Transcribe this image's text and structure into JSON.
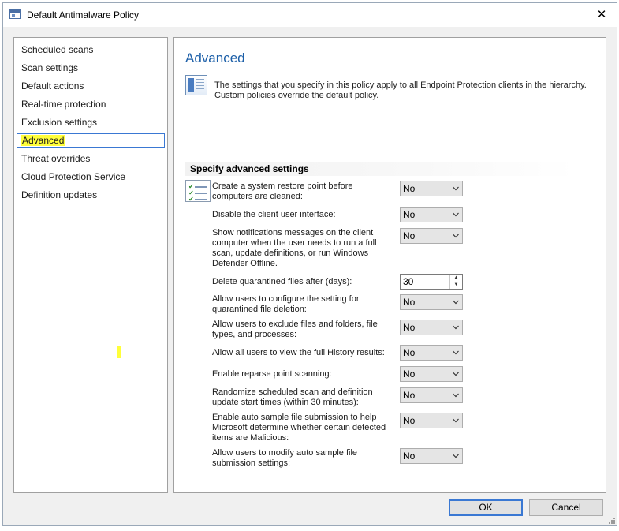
{
  "window": {
    "title": "Default Antimalware Policy",
    "close_glyph": "✕"
  },
  "sidebar": {
    "items": [
      {
        "label": "Scheduled scans"
      },
      {
        "label": "Scan settings"
      },
      {
        "label": "Default actions"
      },
      {
        "label": "Real-time protection"
      },
      {
        "label": "Exclusion settings"
      },
      {
        "label": "Advanced",
        "selected": true
      },
      {
        "label": "Threat overrides"
      },
      {
        "label": "Cloud Protection Service"
      },
      {
        "label": "Definition updates"
      }
    ]
  },
  "main": {
    "title": "Advanced",
    "description": "The settings that you specify in this policy apply to all Endpoint Protection clients in the hierarchy. Custom policies override the default policy.",
    "section_header": "Specify advanced settings",
    "settings": [
      {
        "label": "Create a system restore point before computers are cleaned:",
        "value": "No"
      },
      {
        "label": "Disable the client user interface:",
        "value": "No"
      },
      {
        "label": "Show notifications messages on the client computer when the user needs to run a full scan, update definitions, or run Windows Defender Offline.",
        "value": "No"
      },
      {
        "label": "Delete quarantined files after (days):",
        "value": "30"
      },
      {
        "label": "Allow users to configure the setting for quarantined file deletion:",
        "value": "No"
      },
      {
        "label": "Allow users to exclude files and folders, file types, and processes:",
        "value": "No"
      },
      {
        "label": "Allow all users to view the full History results:",
        "value": "No"
      },
      {
        "label": "Enable reparse point scanning:",
        "value": "No"
      },
      {
        "label": "Randomize scheduled scan and definition update start times (within 30 minutes):",
        "value": "No"
      },
      {
        "label": "Enable auto sample file submission to help Microsoft determine whether certain detected items are Malicious:",
        "value": "No"
      },
      {
        "label": "Allow users to modify auto sample file submission settings:",
        "value": "No"
      }
    ]
  },
  "footer": {
    "ok_label": "OK",
    "cancel_label": "Cancel"
  },
  "colors": {
    "accent": "#3a78d3",
    "title_blue": "#1c5fa8",
    "highlight": "#ffff3a"
  },
  "icons": {
    "app": "policy-window-icon",
    "info": "document-info-icon",
    "settings": "checklist-icon",
    "dropdown": "chevron-down-icon",
    "spinner": "spin-arrows-icon"
  }
}
